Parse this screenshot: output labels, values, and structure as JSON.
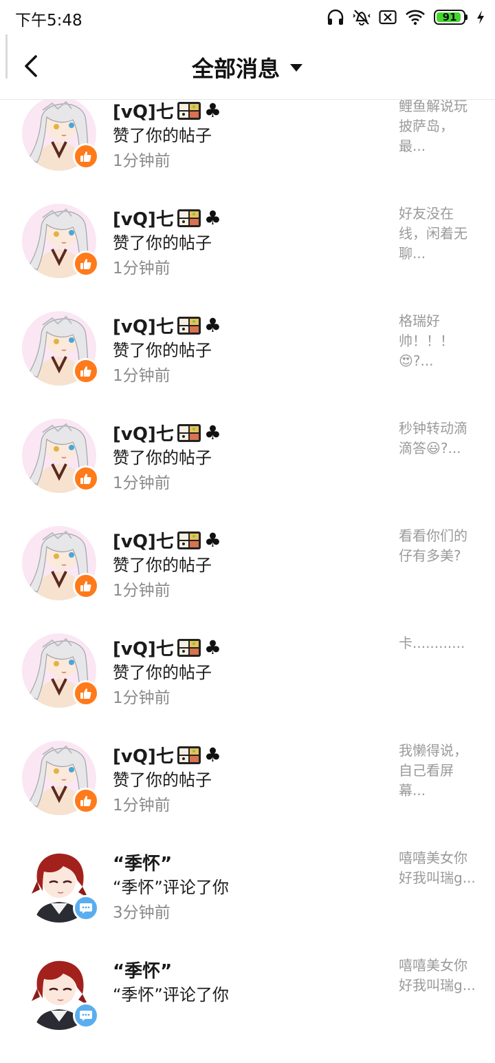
{
  "status_bar": {
    "time": "下午5:48",
    "battery": "91",
    "battery_percent": 91,
    "icons": [
      "headphones-icon",
      "mute-vibrate-icon",
      "close-box-icon",
      "wifi-icon",
      "battery-icon",
      "charging-icon"
    ]
  },
  "header": {
    "title": "全部消息",
    "back_icon": "chevron-left-icon",
    "dropdown_icon": "triangle-down-icon"
  },
  "colors": {
    "like_badge": "#ff7a1a",
    "comment_badge": "#5aaef0",
    "battery_fill": "#44d62c"
  },
  "messages": [
    {
      "name": "[vQ]七",
      "emoji": [
        "bento-icon",
        "club-icon"
      ],
      "action": "赞了你的帖子",
      "time": "1分钟前",
      "preview": "鲤鱼解说玩披萨岛，最...",
      "avatar": "silver-hair-avatar",
      "badge": "like-icon"
    },
    {
      "name": "[vQ]七",
      "emoji": [
        "bento-icon",
        "club-icon"
      ],
      "action": "赞了你的帖子",
      "time": "1分钟前",
      "preview": "好友没在线，闲着无聊...",
      "avatar": "silver-hair-avatar",
      "badge": "like-icon"
    },
    {
      "name": "[vQ]七",
      "emoji": [
        "bento-icon",
        "club-icon"
      ],
      "action": "赞了你的帖子",
      "time": "1分钟前",
      "preview": "格瑞好帅！！！😍?...",
      "avatar": "silver-hair-avatar",
      "badge": "like-icon"
    },
    {
      "name": "[vQ]七",
      "emoji": [
        "bento-icon",
        "club-icon"
      ],
      "action": "赞了你的帖子",
      "time": "1分钟前",
      "preview": "秒钟转动滴滴答😃?...",
      "avatar": "silver-hair-avatar",
      "badge": "like-icon"
    },
    {
      "name": "[vQ]七",
      "emoji": [
        "bento-icon",
        "club-icon"
      ],
      "action": "赞了你的帖子",
      "time": "1分钟前",
      "preview": "看看你们的仔有多美?",
      "avatar": "silver-hair-avatar",
      "badge": "like-icon"
    },
    {
      "name": "[vQ]七",
      "emoji": [
        "bento-icon",
        "club-icon"
      ],
      "action": "赞了你的帖子",
      "time": "1分钟前",
      "preview": "卡............",
      "avatar": "silver-hair-avatar",
      "badge": "like-icon"
    },
    {
      "name": "[vQ]七",
      "emoji": [
        "bento-icon",
        "club-icon"
      ],
      "action": "赞了你的帖子",
      "time": "1分钟前",
      "preview": "我懒得说，自己看屏幕...",
      "avatar": "silver-hair-avatar",
      "badge": "like-icon"
    },
    {
      "name": "“季怀”",
      "emoji": [],
      "action": "“季怀”评论了你",
      "time": "3分钟前",
      "preview": "嘻嘻美女你好我叫瑞g...",
      "avatar": "red-hair-avatar",
      "badge": "comment-icon"
    },
    {
      "name": "“季怀”",
      "emoji": [],
      "action": "“季怀”评论了你",
      "time": "",
      "preview": "嘻嘻美女你好我叫瑞g...",
      "avatar": "red-hair-avatar",
      "badge": "comment-icon"
    }
  ]
}
